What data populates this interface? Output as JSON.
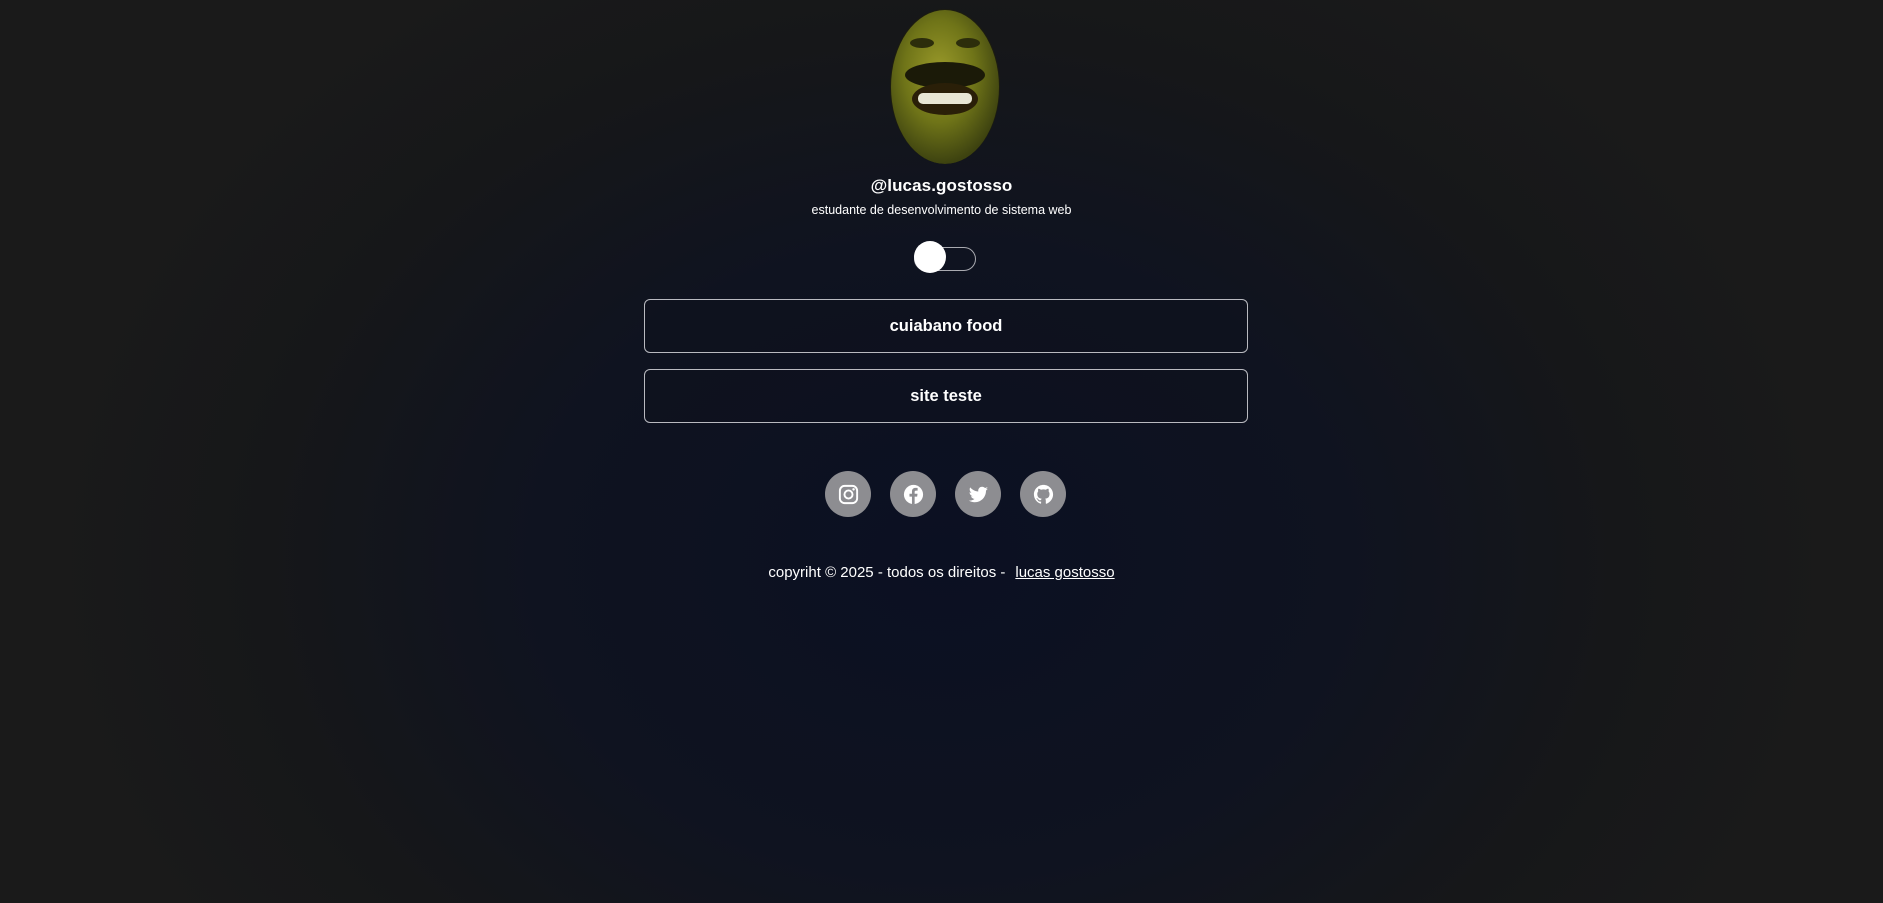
{
  "profile": {
    "handle": "@lucas.gostosso",
    "bio": "estudante de desenvolvimento de sistema web"
  },
  "theme_toggle": {
    "state": "off"
  },
  "links": [
    {
      "label": "cuiabano food"
    },
    {
      "label": "site teste"
    }
  ],
  "socials": [
    {
      "icon": "instagram-icon"
    },
    {
      "icon": "facebook-icon"
    },
    {
      "icon": "twitter-icon"
    },
    {
      "icon": "github-icon"
    }
  ],
  "footer": {
    "text": "copyriht © 2025 - todos os direitos -",
    "link_label": "lucas gostosso"
  },
  "colors": {
    "social_bg": "#8d8d91",
    "border": "#b9bac0"
  }
}
